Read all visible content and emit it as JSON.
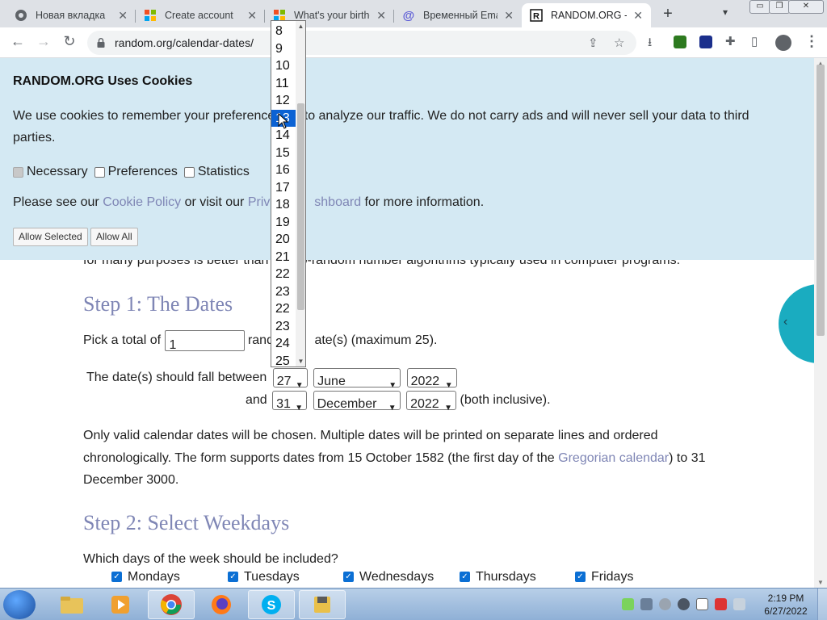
{
  "browser": {
    "tabs": [
      {
        "title": "Новая вкладка",
        "icon": "chrome-icon"
      },
      {
        "title": "Create account",
        "icon": "microsoft-icon"
      },
      {
        "title": "What's your birthd",
        "icon": "microsoft-icon"
      },
      {
        "title": "Временный Email",
        "icon": "at-icon"
      },
      {
        "title": "RANDOM.ORG - C",
        "icon": "random-org-icon",
        "active": true
      }
    ],
    "url": "random.org/calendar-dates/",
    "icons": {
      "minimize": "▭",
      "restore": "❐",
      "close": "✕"
    }
  },
  "cookie": {
    "title": "RANDOM.ORG Uses Cookies",
    "text_a": "We use cookies to remember your preferences",
    "text_b": " to analyze our traffic. We do not carry ads and will never sell your data to third parties.",
    "options": [
      "Necessary",
      "Preferences",
      "Statistics"
    ],
    "see_prefix": "Please see our ",
    "cookie_policy": "Cookie Policy",
    "see_mid": " or visit our ",
    "privacy_a": "Priva",
    "privacy_b": "shboard",
    "see_suffix": " for more information.",
    "btn_allow_selected": "Allow Selected",
    "btn_allow_all": "Allow All"
  },
  "page": {
    "intro": "for many purposes is better than   seudo-random number algorithms typically used in computer programs.",
    "step1_title": "Step 1: The Dates",
    "pick_prefix": "Pick a total of",
    "pick_value": "1",
    "pick_suffix": "ate(s) (maximum 25).",
    "pick_partial": "rand",
    "fall_between": "The date(s) should fall between",
    "start": {
      "day": "27",
      "month": "June",
      "year": "2022"
    },
    "and_label": "and",
    "end": {
      "day": "31",
      "month": "December",
      "year": "2022"
    },
    "inclusive": "(both inclusive).",
    "valid_text_a": "Only valid calendar dates will be chosen. Multiple dates will be printed on separate lines and ordered chronologically. The form supports dates from 15 October 1582 (the first day of the ",
    "gregorian": "Gregorian calendar",
    "valid_text_b": ") to 31 December 3000.",
    "step2_title": "Step 2: Select Weekdays",
    "weekdays_q": "Which days of the week should be included?",
    "weekdays": [
      "Mondays",
      "Tuesdays",
      "Wednesdays",
      "Thursdays",
      "Fridays"
    ],
    "side_arrow": "‹"
  },
  "dropdown": {
    "items": [
      "8",
      "9",
      "10",
      "11",
      "12",
      "13",
      "14",
      "15",
      "16",
      "17",
      "18",
      "19",
      "20",
      "21",
      "22",
      "23",
      "22",
      "23",
      "24",
      "25"
    ],
    "highlighted": "13"
  },
  "taskbar": {
    "time": "2:19 PM",
    "date": "6/27/2022"
  }
}
